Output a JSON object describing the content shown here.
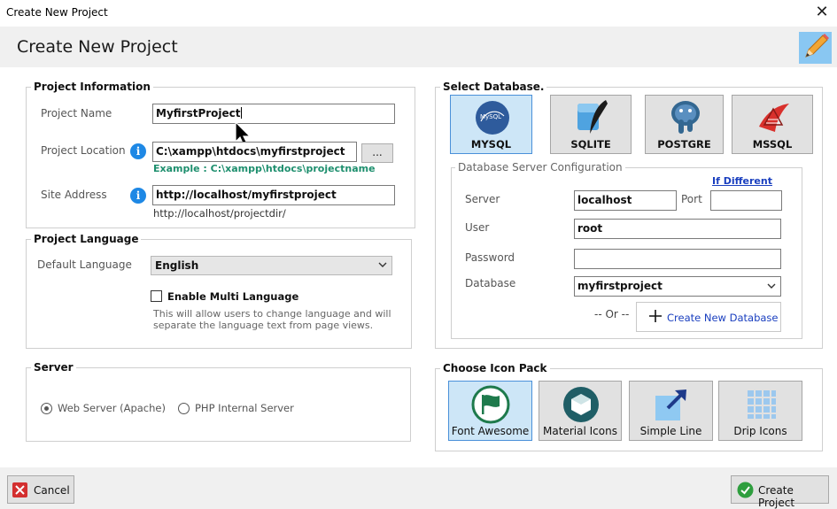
{
  "window": {
    "title": "Create New Project",
    "close_glyph": "✕"
  },
  "header": {
    "title": "Create New Project",
    "icon": "pencil-icon"
  },
  "project_info": {
    "group_title": "Project Information",
    "name_label": "Project Name",
    "name_value": "MyfirstProject",
    "location_label": "Project Location",
    "location_value": "C:\\xampp\\htdocs\\myfirstproject",
    "browse_label": "...",
    "location_example": "Example : C:\\xampp\\htdocs\\projectname",
    "site_label": "Site Address",
    "site_value": "http://localhost/myfirstproject",
    "site_example": "http://localhost/projectdir/"
  },
  "project_language": {
    "group_title": "Project Language",
    "default_label": "Default Language",
    "default_value": "English",
    "multi_label": "Enable Multi Language",
    "multi_checked": false,
    "hint_line1": "This will allow users to change language and will",
    "hint_line2": "separate the language text from page views."
  },
  "server": {
    "group_title": "Server",
    "options": [
      {
        "label": "Web Server (Apache)",
        "selected": true
      },
      {
        "label": "PHP Internal Server",
        "selected": false
      }
    ]
  },
  "database": {
    "group_title": "Select Database.",
    "options": [
      {
        "label": "MYSQL",
        "selected": true,
        "icon": "mysql-icon"
      },
      {
        "label": "SQLITE",
        "selected": false,
        "icon": "sqlite-icon"
      },
      {
        "label": "POSTGRE",
        "selected": false,
        "icon": "postgresql-icon"
      },
      {
        "label": "MSSQL",
        "selected": false,
        "icon": "mssql-icon"
      }
    ],
    "mysql_logo_text": "MySQL",
    "config": {
      "group_title": "Database Server Configuration",
      "if_different": "If Different",
      "server_label": "Server",
      "server_value": "localhost",
      "port_label": "Port",
      "port_value": "",
      "user_label": "User",
      "user_value": "root",
      "password_label": "Password",
      "password_value": "",
      "database_label": "Database",
      "database_value": "myfirstproject",
      "or_text": "-- Or --",
      "create_db_label": "Create New Database"
    }
  },
  "icon_pack": {
    "group_title": "Choose Icon Pack",
    "options": [
      {
        "label": "Font Awesome",
        "selected": true,
        "icon": "flag-icon"
      },
      {
        "label": "Material Icons",
        "selected": false,
        "icon": "material-cube-icon"
      },
      {
        "label": "Simple Line",
        "selected": false,
        "icon": "arrow-up-right-icon"
      },
      {
        "label": "Drip Icons",
        "selected": false,
        "icon": "grid-icon"
      }
    ]
  },
  "footer": {
    "cancel_label": "Cancel",
    "create_label": "Create Project"
  },
  "colors": {
    "accent_blue": "#1e88e5",
    "selected_tile": "#cde6f7",
    "example_green": "#1e8f6e",
    "link_blue": "#1a3fbf"
  }
}
